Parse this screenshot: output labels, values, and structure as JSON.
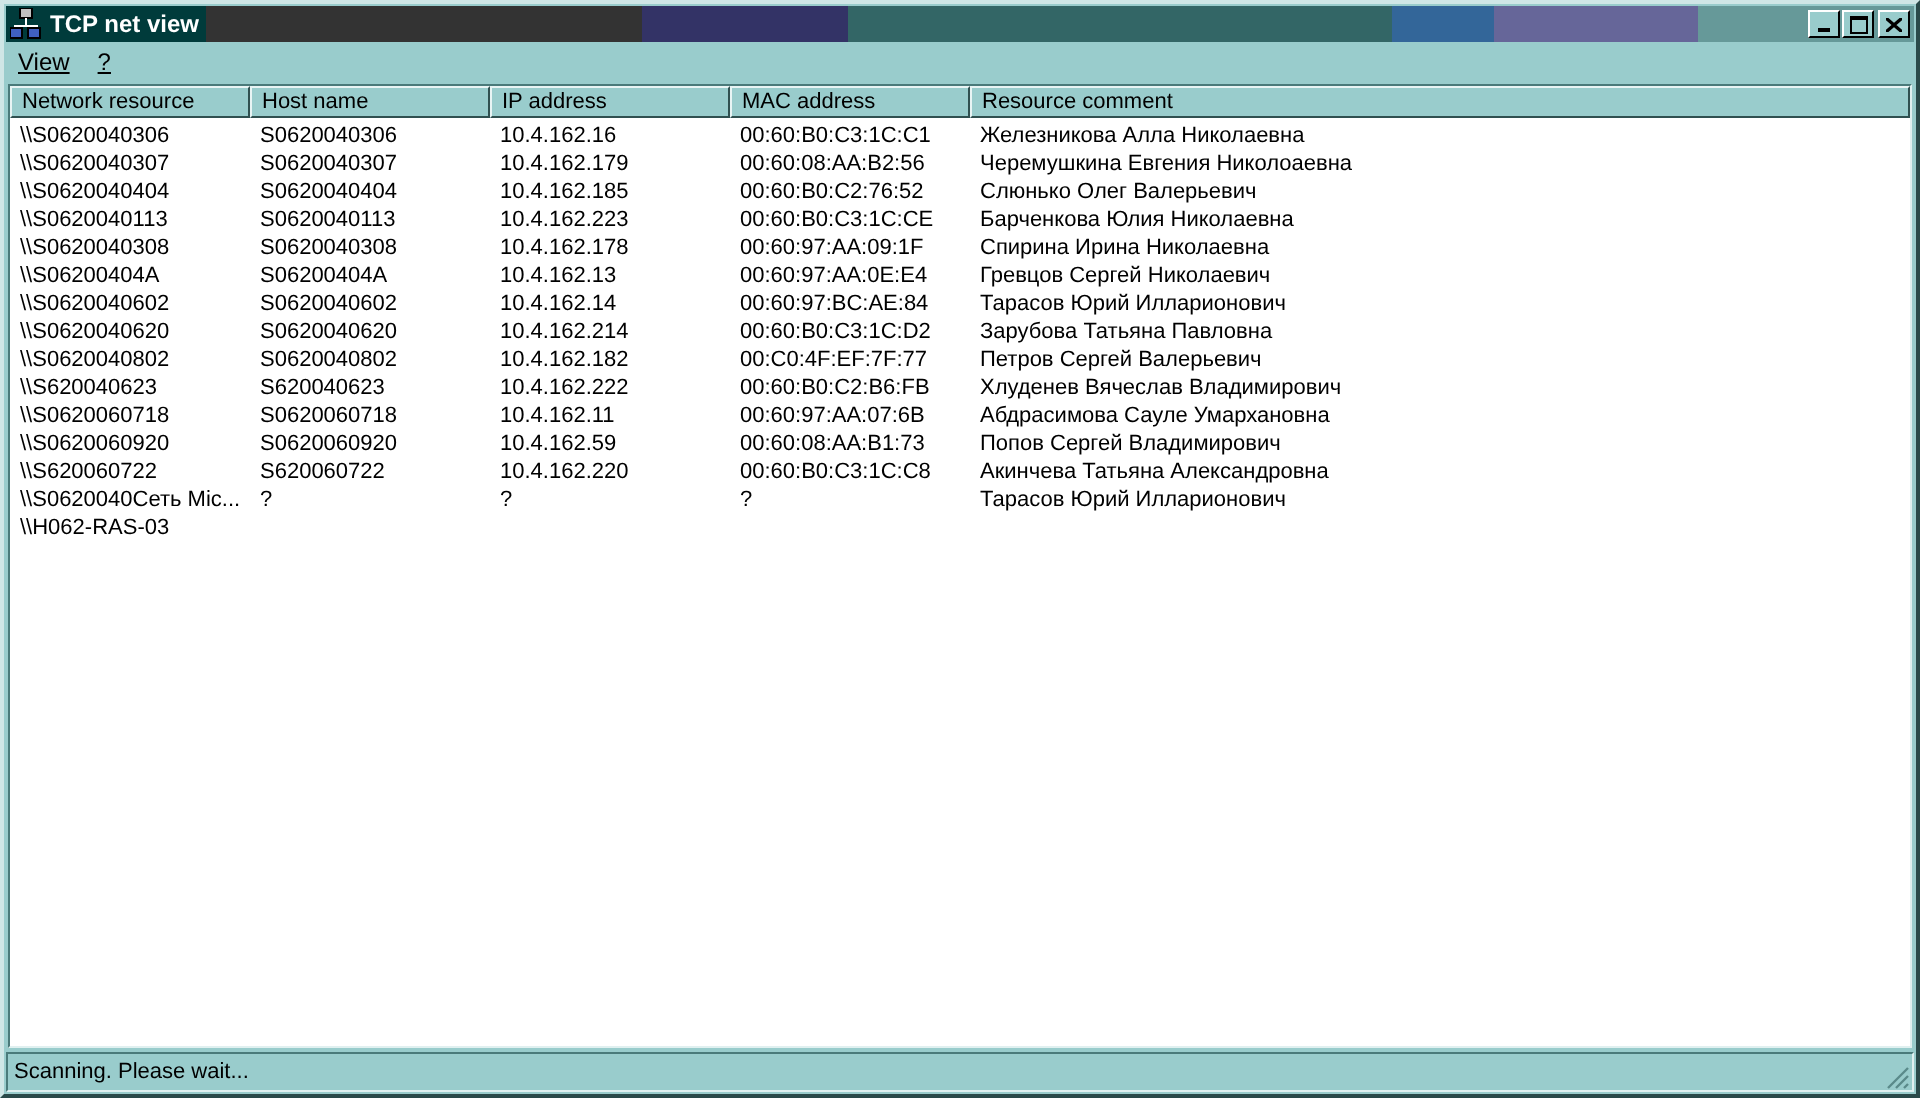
{
  "window": {
    "title": "TCP net view"
  },
  "menu": [
    {
      "label": "View"
    },
    {
      "label": "?"
    }
  ],
  "table": {
    "columns": [
      "Network resource",
      "Host name",
      "IP address",
      "MAC address",
      "Resource comment"
    ],
    "rows": [
      {
        "cells": [
          "\\\\S0620040306",
          "S0620040306",
          "10.4.162.16",
          "00:60:B0:C3:1C:C1",
          "Железникова Алла Николаевна"
        ]
      },
      {
        "cells": [
          "\\\\S0620040307",
          "S0620040307",
          "10.4.162.179",
          "00:60:08:AA:B2:56",
          "Черемушкина Евгения Николоаевна"
        ]
      },
      {
        "cells": [
          "\\\\S0620040404",
          "S0620040404",
          "10.4.162.185",
          "00:60:B0:C2:76:52",
          "Слюнько Олег Валерьевич"
        ]
      },
      {
        "cells": [
          "\\\\S0620040113",
          "S0620040113",
          "10.4.162.223",
          "00:60:B0:C3:1C:CE",
          "Барченкова Юлия Николаевна"
        ]
      },
      {
        "cells": [
          "\\\\S0620040308",
          "S0620040308",
          "10.4.162.178",
          "00:60:97:AA:09:1F",
          "Спирина Ирина Николаевна"
        ]
      },
      {
        "cells": [
          "\\\\S06200404A",
          "S06200404A",
          "10.4.162.13",
          "00:60:97:AA:0E:E4",
          "Гревцов Сергей Николаевич"
        ]
      },
      {
        "cells": [
          "\\\\S0620040602",
          "S0620040602",
          "10.4.162.14",
          "00:60:97:BC:AE:84",
          "Тарасов Юрий Илларионович"
        ]
      },
      {
        "cells": [
          "\\\\S0620040620",
          "S0620040620",
          "10.4.162.214",
          "00:60:B0:C3:1C:D2",
          "Зарубова Татьяна Павловна"
        ]
      },
      {
        "cells": [
          "\\\\S0620040802",
          "S0620040802",
          "10.4.162.182",
          "00:C0:4F:EF:7F:77",
          "Петров Сергей Валерьевич"
        ]
      },
      {
        "cells": [
          "\\\\S620040623",
          "S620040623",
          "10.4.162.222",
          "00:60:B0:C2:B6:FB",
          "Хлуденев Вячеслав Владимирович"
        ]
      },
      {
        "cells": [
          "\\\\S0620060718",
          "S0620060718",
          "10.4.162.11",
          "00:60:97:AA:07:6B",
          "Абдрасимова Сауле Умархановна"
        ]
      },
      {
        "cells": [
          "\\\\S0620060920",
          "S0620060920",
          "10.4.162.59",
          "00:60:08:AA:B1:73",
          "Попов Сергей Владимирович"
        ]
      },
      {
        "cells": [
          "\\\\S620060722",
          "S620060722",
          "10.4.162.220",
          "00:60:B0:C3:1C:C8",
          "Акинчева Татьяна Александровна"
        ]
      },
      {
        "cells": [
          "\\\\S0620040Сеть Mic...",
          "?",
          "?",
          "?",
          "Тарасов Юрий Илларионович"
        ]
      },
      {
        "cells": [
          "\\\\H062-RAS-03"
        ]
      }
    ]
  },
  "status_bar": "Scanning. Please wait..."
}
